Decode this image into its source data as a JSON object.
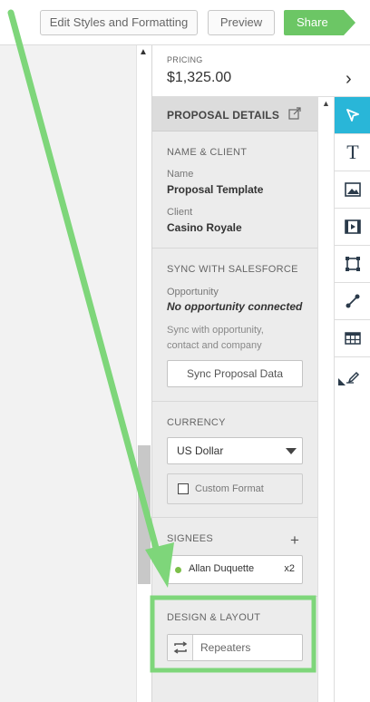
{
  "toolbar": {
    "edit_label": "Edit Styles and Formatting",
    "preview_label": "Preview",
    "share_label": "Share",
    "share_color": "#6cc665"
  },
  "pricing": {
    "label": "PRICING",
    "value": "$1,325.00"
  },
  "proposal_details": {
    "title": "PROPOSAL DETAILS",
    "name_client": {
      "section": "NAME & CLIENT",
      "name_label": "Name",
      "name_value": "Proposal Template",
      "client_label": "Client",
      "client_value": "Casino Royale"
    },
    "salesforce": {
      "section": "SYNC WITH SALESFORCE",
      "opportunity_label": "Opportunity",
      "opportunity_value": "No opportunity connected",
      "helper_line1": "Sync with opportunity,",
      "helper_line2": "contact and company",
      "sync_button": "Sync Proposal Data"
    },
    "currency": {
      "section": "CURRENCY",
      "selected": "US Dollar",
      "custom_format_label": "Custom Format",
      "custom_format_checked": false
    },
    "signees": {
      "section": "SIGNEES",
      "items": [
        {
          "name": "Allan Duquette",
          "count": "x2",
          "status_color": "#7cbf4a"
        }
      ]
    },
    "design_layout": {
      "section": "DESIGN & LAYOUT",
      "repeaters_label": "Repeaters"
    }
  },
  "tools": [
    {
      "icon": "pointer-icon",
      "active": true
    },
    {
      "icon": "text-icon",
      "active": false
    },
    {
      "icon": "image-icon",
      "active": false
    },
    {
      "icon": "video-icon",
      "active": false
    },
    {
      "icon": "shape-icon",
      "active": false
    },
    {
      "icon": "line-icon",
      "active": false
    },
    {
      "icon": "table-icon",
      "active": false
    },
    {
      "icon": "signature-icon",
      "active": false
    }
  ],
  "colors": {
    "accent": "#29b6d8",
    "annotation": "#7ed67a"
  }
}
